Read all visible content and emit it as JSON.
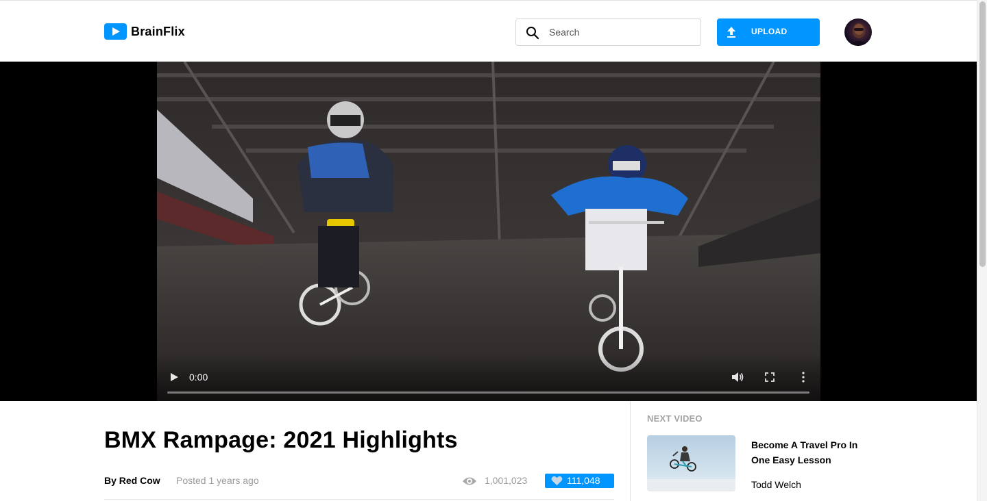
{
  "app": {
    "name": "BrainFlix",
    "brand_color": "#0095ff"
  },
  "header": {
    "search": {
      "placeholder": "Search",
      "value": ""
    },
    "upload_label": "UPLOAD",
    "icons": {
      "search": "search-icon",
      "upload": "upload-icon",
      "logo": "play-logo-icon"
    }
  },
  "player": {
    "current_time": "0:00",
    "progress": 0,
    "controls": [
      "play-icon",
      "volume-icon",
      "fullscreen-icon",
      "more-vertical-icon"
    ]
  },
  "video": {
    "title": "BMX Rampage: 2021 Highlights",
    "author": "By Red Cow",
    "posted": "Posted 1 years ago",
    "views": "1,001,023",
    "likes": "111,048",
    "icons": {
      "views": "eye-icon",
      "likes": "heart-icon"
    }
  },
  "sidebar": {
    "heading": "NEXT VIDEO",
    "items": [
      {
        "title": "Become A Travel Pro In One Easy Lesson",
        "author": "Todd Welch"
      }
    ]
  }
}
